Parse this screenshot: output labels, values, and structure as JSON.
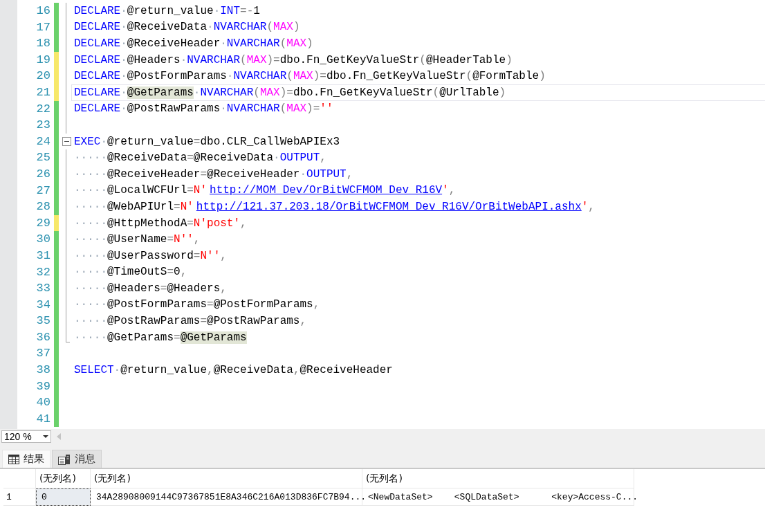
{
  "editor": {
    "lines": [
      {
        "number": "16",
        "modified": false,
        "current": false,
        "outlined": true,
        "tokens": [
          {
            "kind": "kw",
            "text": "DECLARE"
          },
          {
            "kind": "ws",
            "text": "·"
          },
          {
            "kind": "plain",
            "text": "@return_value"
          },
          {
            "kind": "ws",
            "text": "·"
          },
          {
            "kind": "kw",
            "text": "INT"
          },
          {
            "kind": "op",
            "text": "=-"
          },
          {
            "kind": "plain",
            "text": "1"
          }
        ]
      },
      {
        "number": "17",
        "modified": false,
        "current": false,
        "outlined": true,
        "tokens": [
          {
            "kind": "kw",
            "text": "DECLARE"
          },
          {
            "kind": "ws",
            "text": "·"
          },
          {
            "kind": "plain",
            "text": "@ReceiveData"
          },
          {
            "kind": "ws",
            "text": "·"
          },
          {
            "kind": "kw",
            "text": "NVARCHAR"
          },
          {
            "kind": "op",
            "text": "("
          },
          {
            "kind": "fn",
            "text": "MAX"
          },
          {
            "kind": "op",
            "text": ")"
          }
        ]
      },
      {
        "number": "18",
        "modified": false,
        "current": false,
        "outlined": true,
        "tokens": [
          {
            "kind": "kw",
            "text": "DECLARE"
          },
          {
            "kind": "ws",
            "text": "·"
          },
          {
            "kind": "plain",
            "text": "@ReceiveHeader"
          },
          {
            "kind": "ws",
            "text": "·"
          },
          {
            "kind": "kw",
            "text": "NVARCHAR"
          },
          {
            "kind": "op",
            "text": "("
          },
          {
            "kind": "fn",
            "text": "MAX"
          },
          {
            "kind": "op",
            "text": ")"
          }
        ]
      },
      {
        "number": "19",
        "modified": true,
        "current": false,
        "outlined": true,
        "tokens": [
          {
            "kind": "kw",
            "text": "DECLARE"
          },
          {
            "kind": "ws",
            "text": "·"
          },
          {
            "kind": "plain",
            "text": "@Headers"
          },
          {
            "kind": "ws",
            "text": "·"
          },
          {
            "kind": "kw",
            "text": "NVARCHAR"
          },
          {
            "kind": "op",
            "text": "("
          },
          {
            "kind": "fn",
            "text": "MAX"
          },
          {
            "kind": "op",
            "text": ")="
          },
          {
            "kind": "plain",
            "text": "dbo.Fn_GetKeyValueStr"
          },
          {
            "kind": "op",
            "text": "("
          },
          {
            "kind": "plain",
            "text": "@HeaderTable"
          },
          {
            "kind": "op",
            "text": ")"
          }
        ]
      },
      {
        "number": "20",
        "modified": true,
        "current": false,
        "outlined": true,
        "tokens": [
          {
            "kind": "kw",
            "text": "DECLARE"
          },
          {
            "kind": "ws",
            "text": "·"
          },
          {
            "kind": "plain",
            "text": "@PostFormParams"
          },
          {
            "kind": "ws",
            "text": "·"
          },
          {
            "kind": "kw",
            "text": "NVARCHAR"
          },
          {
            "kind": "op",
            "text": "("
          },
          {
            "kind": "fn",
            "text": "MAX"
          },
          {
            "kind": "op",
            "text": ")="
          },
          {
            "kind": "plain",
            "text": "dbo.Fn_GetKeyValueStr"
          },
          {
            "kind": "op",
            "text": "("
          },
          {
            "kind": "plain",
            "text": "@FormTable"
          },
          {
            "kind": "op",
            "text": ")"
          }
        ]
      },
      {
        "number": "21",
        "modified": true,
        "current": true,
        "outlined": true,
        "tokens": [
          {
            "kind": "kw",
            "text": "DECLARE"
          },
          {
            "kind": "ws",
            "text": "·"
          },
          {
            "kind": "hl",
            "text": "@GetParams"
          },
          {
            "kind": "ws",
            "text": "·"
          },
          {
            "kind": "kw",
            "text": "NVARCHAR"
          },
          {
            "kind": "op",
            "text": "("
          },
          {
            "kind": "fn",
            "text": "MAX"
          },
          {
            "kind": "op",
            "text": ")="
          },
          {
            "kind": "plain",
            "text": "dbo.Fn_GetKeyValueStr"
          },
          {
            "kind": "op",
            "text": "("
          },
          {
            "kind": "plain",
            "text": "@UrlTable"
          },
          {
            "kind": "op",
            "text": ")"
          }
        ]
      },
      {
        "number": "22",
        "modified": false,
        "current": false,
        "outlined": true,
        "tokens": [
          {
            "kind": "kw",
            "text": "DECLARE"
          },
          {
            "kind": "ws",
            "text": "·"
          },
          {
            "kind": "plain",
            "text": "@PostRawParams"
          },
          {
            "kind": "ws",
            "text": "·"
          },
          {
            "kind": "kw",
            "text": "NVARCHAR"
          },
          {
            "kind": "op",
            "text": "("
          },
          {
            "kind": "fn",
            "text": "MAX"
          },
          {
            "kind": "op",
            "text": ")="
          },
          {
            "kind": "str",
            "text": "''"
          }
        ]
      },
      {
        "number": "23",
        "modified": false,
        "current": false,
        "outlined": true
      },
      {
        "number": "24",
        "modified": false,
        "current": false,
        "outlined": true,
        "expanded": true,
        "tokens": [
          {
            "kind": "kw",
            "text": "EXEC"
          },
          {
            "kind": "ws",
            "text": "·"
          },
          {
            "kind": "plain",
            "text": "@return_value"
          },
          {
            "kind": "op",
            "text": "="
          },
          {
            "kind": "plain",
            "text": "dbo.CLR_CallWebAPIEx3"
          }
        ]
      },
      {
        "number": "25",
        "modified": false,
        "current": false,
        "outlined": true,
        "tokens": [
          {
            "kind": "ws",
            "text": "·····"
          },
          {
            "kind": "plain",
            "text": "@ReceiveData"
          },
          {
            "kind": "op",
            "text": "="
          },
          {
            "kind": "plain",
            "text": "@ReceiveData"
          },
          {
            "kind": "ws",
            "text": "·"
          },
          {
            "kind": "kw",
            "text": "OUTPUT"
          },
          {
            "kind": "op",
            "text": ","
          }
        ]
      },
      {
        "number": "26",
        "modified": false,
        "current": false,
        "outlined": true,
        "tokens": [
          {
            "kind": "ws",
            "text": "·····"
          },
          {
            "kind": "plain",
            "text": "@ReceiveHeader"
          },
          {
            "kind": "op",
            "text": "="
          },
          {
            "kind": "plain",
            "text": "@ReceiveHeader"
          },
          {
            "kind": "ws",
            "text": "·"
          },
          {
            "kind": "kw",
            "text": "OUTPUT"
          },
          {
            "kind": "op",
            "text": ","
          }
        ]
      },
      {
        "number": "27",
        "modified": false,
        "current": false,
        "outlined": true,
        "tokens": [
          {
            "kind": "ws",
            "text": "·····"
          },
          {
            "kind": "plain",
            "text": "@LocalWCFUrl"
          },
          {
            "kind": "op",
            "text": "="
          },
          {
            "kind": "str",
            "text": "N'"
          },
          {
            "kind": "link",
            "text": "http://MOM_Dev/OrBitWCFMOM_Dev_R16V"
          },
          {
            "kind": "str",
            "text": "'"
          },
          {
            "kind": "op",
            "text": ","
          }
        ]
      },
      {
        "number": "28",
        "modified": false,
        "current": false,
        "outlined": true,
        "tokens": [
          {
            "kind": "ws",
            "text": "·····"
          },
          {
            "kind": "plain",
            "text": "@WebAPIUrl"
          },
          {
            "kind": "op",
            "text": "="
          },
          {
            "kind": "str",
            "text": "N'"
          },
          {
            "kind": "link",
            "text": "http://121.37.203.18/OrBitWCFMOM_Dev_R16V/OrBitWebAPI.ashx"
          },
          {
            "kind": "str",
            "text": "'"
          },
          {
            "kind": "op",
            "text": ","
          }
        ]
      },
      {
        "number": "29",
        "modified": true,
        "current": false,
        "outlined": true,
        "tokens": [
          {
            "kind": "ws",
            "text": "·····"
          },
          {
            "kind": "plain",
            "text": "@HttpMethodA"
          },
          {
            "kind": "op",
            "text": "="
          },
          {
            "kind": "str",
            "text": "N'post'"
          },
          {
            "kind": "op",
            "text": ","
          }
        ]
      },
      {
        "number": "30",
        "modified": false,
        "current": false,
        "outlined": true,
        "tokens": [
          {
            "kind": "ws",
            "text": "·····"
          },
          {
            "kind": "plain",
            "text": "@UserName"
          },
          {
            "kind": "op",
            "text": "="
          },
          {
            "kind": "str",
            "text": "N''"
          },
          {
            "kind": "op",
            "text": ","
          }
        ]
      },
      {
        "number": "31",
        "modified": false,
        "current": false,
        "outlined": true,
        "tokens": [
          {
            "kind": "ws",
            "text": "·····"
          },
          {
            "kind": "plain",
            "text": "@UserPassword"
          },
          {
            "kind": "op",
            "text": "="
          },
          {
            "kind": "str",
            "text": "N''"
          },
          {
            "kind": "op",
            "text": ","
          }
        ]
      },
      {
        "number": "32",
        "modified": false,
        "current": false,
        "outlined": true,
        "tokens": [
          {
            "kind": "ws",
            "text": "·····"
          },
          {
            "kind": "plain",
            "text": "@TimeOutS"
          },
          {
            "kind": "op",
            "text": "="
          },
          {
            "kind": "plain",
            "text": "0"
          },
          {
            "kind": "op",
            "text": ","
          }
        ]
      },
      {
        "number": "33",
        "modified": false,
        "current": false,
        "outlined": true,
        "tokens": [
          {
            "kind": "ws",
            "text": "·····"
          },
          {
            "kind": "plain",
            "text": "@Headers"
          },
          {
            "kind": "op",
            "text": "="
          },
          {
            "kind": "plain",
            "text": "@Headers"
          },
          {
            "kind": "op",
            "text": ","
          }
        ]
      },
      {
        "number": "34",
        "modified": false,
        "current": false,
        "outlined": true,
        "tokens": [
          {
            "kind": "ws",
            "text": "·····"
          },
          {
            "kind": "plain",
            "text": "@PostFormParams"
          },
          {
            "kind": "op",
            "text": "="
          },
          {
            "kind": "plain",
            "text": "@PostFormParams"
          },
          {
            "kind": "op",
            "text": ","
          }
        ]
      },
      {
        "number": "35",
        "modified": false,
        "current": false,
        "outlined": true,
        "tokens": [
          {
            "kind": "ws",
            "text": "·····"
          },
          {
            "kind": "plain",
            "text": "@PostRawParams"
          },
          {
            "kind": "op",
            "text": "="
          },
          {
            "kind": "plain",
            "text": "@PostRawParams"
          },
          {
            "kind": "op",
            "text": ","
          }
        ]
      },
      {
        "number": "36",
        "modified": false,
        "current": false,
        "outlined": true,
        "tokens": [
          {
            "kind": "ws",
            "text": "·····"
          },
          {
            "kind": "plain",
            "text": "@GetParams"
          },
          {
            "kind": "op",
            "text": "="
          },
          {
            "kind": "hl",
            "text": "@GetParams"
          }
        ]
      },
      {
        "number": "37",
        "modified": false,
        "current": false,
        "outlined": false
      },
      {
        "number": "38",
        "modified": false,
        "current": false,
        "outlined": false,
        "tokens": [
          {
            "kind": "kw",
            "text": "SELECT"
          },
          {
            "kind": "ws",
            "text": "·"
          },
          {
            "kind": "plain",
            "text": "@return_value"
          },
          {
            "kind": "op",
            "text": ","
          },
          {
            "kind": "plain",
            "text": "@ReceiveData"
          },
          {
            "kind": "op",
            "text": ","
          },
          {
            "kind": "plain",
            "text": "@ReceiveHeader"
          }
        ]
      },
      {
        "number": "39",
        "modified": false,
        "current": false,
        "outlined": false
      },
      {
        "number": "40",
        "modified": false,
        "current": false,
        "outlined": false
      },
      {
        "number": "41",
        "modified": false,
        "current": false,
        "outlined": false
      }
    ]
  },
  "zoom": {
    "value": "120 %"
  },
  "result_tabs": [
    {
      "label": "结果",
      "kind": "grid",
      "selected": true
    },
    {
      "label": "消息",
      "kind": "messages",
      "selected": false
    }
  ],
  "results": {
    "columns": [
      "(无列名)",
      "(无列名)",
      "(无列名)"
    ],
    "rows": [
      {
        "number": "1",
        "cells": [
          {
            "text": "0",
            "selected": true
          },
          {
            "text": "34A28908009144C97367851E8A346C216A013D836FC7B94...",
            "selected": false
          },
          {
            "text": "<NewDataSet>    <SQLDataSet>      <key>Access-C...",
            "selected": false
          }
        ]
      }
    ]
  }
}
